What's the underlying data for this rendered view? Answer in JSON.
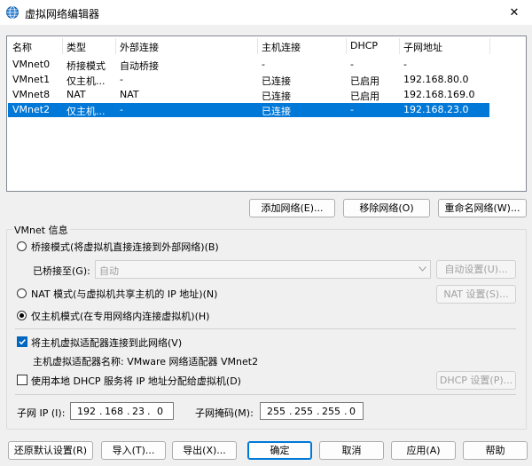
{
  "window": {
    "title": "虚拟网络编辑器",
    "close_glyph": "✕"
  },
  "colors": {
    "selection": "#0078d7",
    "accent": "#0067c0"
  },
  "table": {
    "headers": [
      "名称",
      "类型",
      "外部连接",
      "主机连接",
      "DHCP",
      "子网地址"
    ],
    "rows": [
      [
        "VMnet0",
        "桥接模式",
        "自动桥接",
        "-",
        "-",
        "-"
      ],
      [
        "VMnet1",
        "仅主机...",
        "-",
        "已连接",
        "已启用",
        "192.168.80.0"
      ],
      [
        "VMnet8",
        "NAT",
        "NAT",
        "已连接",
        "已启用",
        "192.168.169.0"
      ],
      [
        "VMnet2",
        "仅主机...",
        "-",
        "已连接",
        "-",
        "192.168.23.0"
      ]
    ],
    "selected_row": 3
  },
  "list_buttons": {
    "add": "添加网络(E)...",
    "remove": "移除网络(O)",
    "rename": "重命名网络(W)..."
  },
  "vmnet_info": {
    "title": "VMnet 信息",
    "bridged": {
      "label": "桥接模式(将虚拟机直接连接到外部网络)(B)",
      "checked": false
    },
    "bridged_to": {
      "label": "已桥接至(G):",
      "value": "自动",
      "auto_button": "自动设置(U)..."
    },
    "nat": {
      "label": "NAT 模式(与虚拟机共享主机的 IP 地址)(N)",
      "checked": false,
      "settings_button": "NAT 设置(S)..."
    },
    "host_only": {
      "label": "仅主机模式(在专用网络内连接虚拟机)(H)",
      "checked": true
    },
    "connect_adapter": {
      "label": "将主机虚拟适配器连接到此网络(V)",
      "checked": true
    },
    "adapter_name": "主机虚拟适配器名称: VMware 网络适配器 VMnet2",
    "dhcp": {
      "label": "使用本地 DHCP 服务将 IP 地址分配给虚拟机(D)",
      "checked": false,
      "settings_button": "DHCP 设置(P)..."
    },
    "subnet_ip": {
      "label": "子网 IP (I):",
      "octets": [
        "192",
        "168",
        "23",
        "0"
      ]
    },
    "subnet_mask": {
      "label": "子网掩码(M):",
      "octets": [
        "255",
        "255",
        "255",
        "0"
      ]
    }
  },
  "footer": {
    "restore": "还原默认设置(R)",
    "import": "导入(T)...",
    "export": "导出(X)...",
    "ok": "确定",
    "cancel": "取消",
    "apply": "应用(A)",
    "help": "帮助"
  }
}
